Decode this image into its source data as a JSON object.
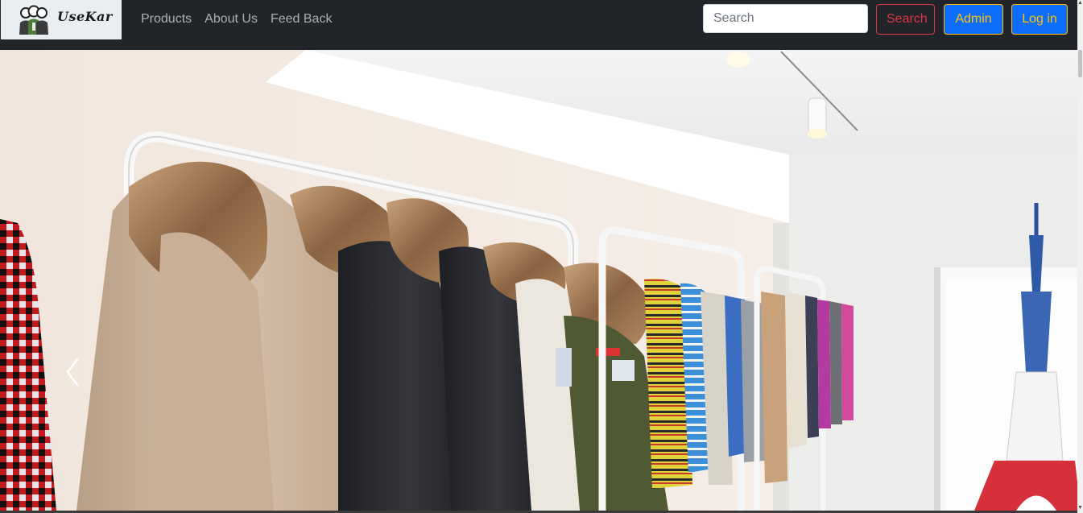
{
  "brand": {
    "name": "UseKar",
    "logo_icon": "people-logo-icon"
  },
  "nav": {
    "items": [
      {
        "label": "Products"
      },
      {
        "label": "About Us"
      },
      {
        "label": "Feed Back"
      }
    ]
  },
  "search": {
    "placeholder": "Search",
    "value": "",
    "button_label": "Search"
  },
  "actions": {
    "admin_label": "Admin",
    "login_label": "Log in"
  },
  "carousel": {
    "prev_icon": "chevron-left-icon",
    "slide_alt": "Clothing rack with winter jackets and sweaters"
  },
  "colors": {
    "navbar_bg": "#212529",
    "search_button": "#dc3545",
    "primary": "#0d6efd",
    "warning_text": "#ffc107"
  }
}
